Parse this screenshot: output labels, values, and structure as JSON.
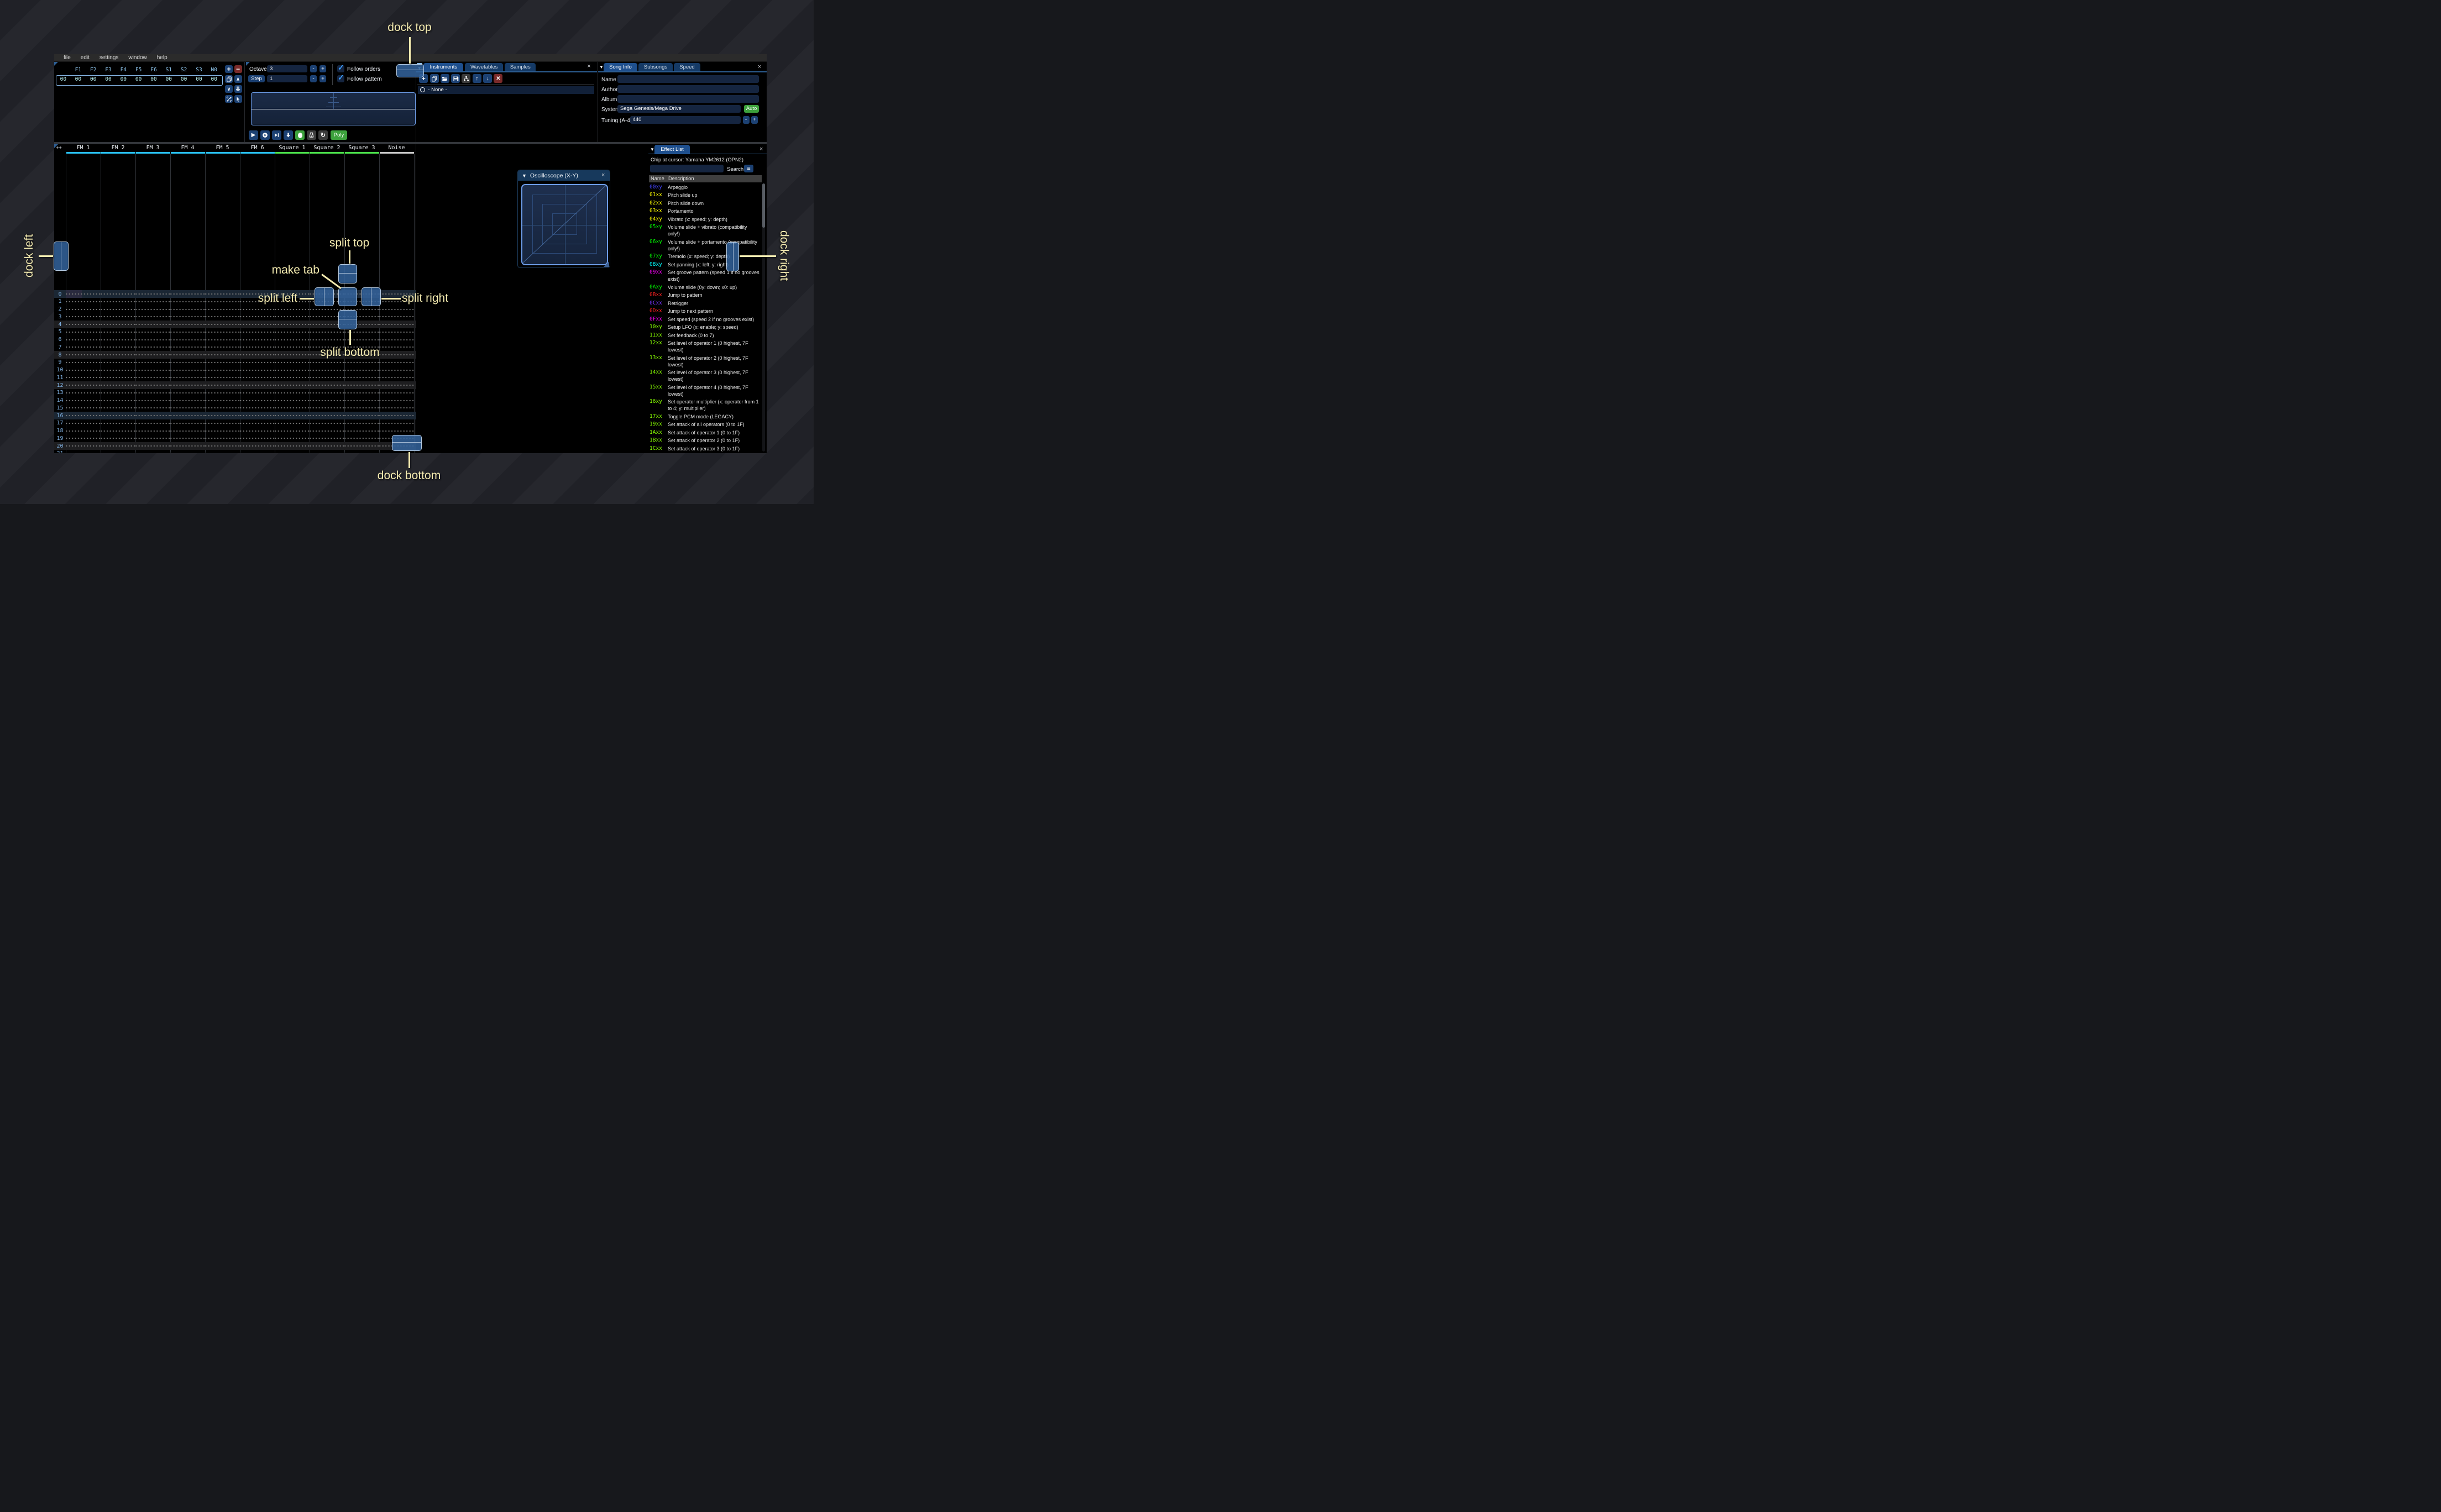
{
  "app": {
    "menu": [
      "file",
      "edit",
      "settings",
      "window",
      "help"
    ]
  },
  "order_list": {
    "row_number": "00",
    "channels": [
      "F1",
      "F2",
      "F3",
      "F4",
      "F5",
      "F6",
      "S1",
      "S2",
      "S3",
      "N0"
    ],
    "values": [
      "00",
      "00",
      "00",
      "00",
      "00",
      "00",
      "00",
      "00",
      "00",
      "00"
    ],
    "toolbar": [
      {
        "name": "add-order-button",
        "icon": "plus",
        "color": "b-blue"
      },
      {
        "name": "remove-order-button",
        "icon": "minus",
        "color": "b-red"
      },
      {
        "name": "duplicate-order-button",
        "icon": "copy",
        "color": "b-blue"
      },
      {
        "name": "move-order-up-button",
        "icon": "chev-up",
        "color": "b-blue"
      },
      {
        "name": "move-order-down-button",
        "icon": "chev-down",
        "color": "b-blue"
      },
      {
        "name": "duplicate-order-end-button",
        "icon": "chev-ddown",
        "color": "b-blue"
      },
      {
        "name": "order-change-mode-button",
        "icon": "unlink",
        "color": "b-blue"
      },
      {
        "name": "order-edit-mode-button",
        "icon": "cursor",
        "color": "b-blue"
      }
    ]
  },
  "edit_controls": {
    "octave_label": "Octave",
    "octave_value": "3",
    "step_label": "Step",
    "step_value": "1",
    "minus_label": "-",
    "plus_label": "+",
    "follow_orders_label": "Follow orders",
    "follow_pattern_label": "Follow pattern",
    "check_glyph": "✓"
  },
  "playback": {
    "buttons": [
      {
        "name": "play-button",
        "icon": "play",
        "color": "b-blue"
      },
      {
        "name": "play-pattern-button",
        "icon": "play-circle",
        "color": "b-blue"
      },
      {
        "name": "play-from-cursor-button",
        "icon": "play-bar",
        "color": "b-blue"
      },
      {
        "name": "step-one-row-button",
        "icon": "arrow-down-bold",
        "color": "b-blue"
      },
      {
        "name": "edit-record-button",
        "icon": "record-oval",
        "color": "b-green"
      },
      {
        "name": "metronome-button",
        "icon": "metronome",
        "color": "b-gray"
      },
      {
        "name": "repeat-pattern-button",
        "icon": "repeat",
        "color": "b-gray"
      }
    ],
    "poly_label": "Poly"
  },
  "instruments_panel": {
    "tabs": [
      {
        "label": "Instruments",
        "active": true
      },
      {
        "label": "Wavetables",
        "active": false
      },
      {
        "label": "Samples",
        "active": false
      }
    ],
    "close_glyph": "×",
    "collapse_glyph": "▼",
    "toolbar": [
      {
        "name": "add-instrument-button",
        "icon": "plus",
        "color": "b-blue"
      },
      {
        "name": "duplicate-instrument-button",
        "icon": "copy",
        "color": "b-blue"
      },
      {
        "name": "open-instrument-button",
        "icon": "folder",
        "color": "b-blue"
      },
      {
        "name": "save-instrument-button",
        "icon": "save",
        "color": "b-blue"
      },
      {
        "name": "instrument-folders-button",
        "icon": "tree",
        "color": "b-gray"
      },
      {
        "name": "move-instrument-up-button",
        "icon": "arrow-up",
        "color": "b-blue"
      },
      {
        "name": "move-instrument-down-button",
        "icon": "arrow-down",
        "color": "b-blue"
      },
      {
        "name": "delete-instrument-button",
        "icon": "cross",
        "color": "b-red"
      }
    ],
    "list": [
      {
        "label": "- None -"
      }
    ]
  },
  "song_info": {
    "tabs": [
      {
        "label": "Song Info",
        "active": true
      },
      {
        "label": "Subsongs",
        "active": false
      },
      {
        "label": "Speed",
        "active": false
      }
    ],
    "name_label": "Name",
    "name_value": "",
    "author_label": "Author",
    "author_value": "",
    "album_label": "Album",
    "album_value": "",
    "system_label": "System",
    "system_value": "Sega Genesis/Mega Drive",
    "auto_label": "Auto",
    "tuning_label": "Tuning (A-4)",
    "tuning_value": "440",
    "minus_label": "-",
    "plus_label": "+"
  },
  "oscilloscope": {
    "title": "Oscilloscope (X-Y)",
    "collapse_glyph": "▼",
    "close_glyph": "×"
  },
  "pattern": {
    "expand_label": "++",
    "row_count": 22,
    "highlight_minor": 4,
    "highlight_major": 16,
    "channels": [
      {
        "name": "FM 1",
        "color": "#29c0f0"
      },
      {
        "name": "FM 2",
        "color": "#29c0f0"
      },
      {
        "name": "FM 3",
        "color": "#29c0f0"
      },
      {
        "name": "FM 4",
        "color": "#29c0f0"
      },
      {
        "name": "FM 5",
        "color": "#29c0f0"
      },
      {
        "name": "FM 6",
        "color": "#29c0f0"
      },
      {
        "name": "Square 1",
        "color": "#4be04b"
      },
      {
        "name": "Square 2",
        "color": "#4be04b"
      },
      {
        "name": "Square 3",
        "color": "#4be04b"
      },
      {
        "name": "Noise",
        "color": "#c8c8c8"
      }
    ]
  },
  "effect_list": {
    "tab_label": "Effect List",
    "chip_line": "Chip at cursor: Yamaha YM2612 (OPN2)",
    "search_label": "Search",
    "search_value": "",
    "columns": [
      "Name",
      "Description"
    ],
    "rows": [
      {
        "code": "00xy",
        "color": "#4444ff",
        "desc": "Arpeggio"
      },
      {
        "code": "01xx",
        "color": "#ffff00",
        "desc": "Pitch slide up"
      },
      {
        "code": "02xx",
        "color": "#ffff00",
        "desc": "Pitch slide down"
      },
      {
        "code": "03xx",
        "color": "#ffff00",
        "desc": "Portamento"
      },
      {
        "code": "04xy",
        "color": "#ffff00",
        "desc": "Vibrato (x: speed; y: depth)"
      },
      {
        "code": "05xy",
        "color": "#00ff00",
        "desc": "Volume slide + vibrato (compatibility only!)"
      },
      {
        "code": "06xy",
        "color": "#00ff00",
        "desc": "Volume slide + portamento (compatibility only!)"
      },
      {
        "code": "07xy",
        "color": "#00ff00",
        "desc": "Tremolo (x: speed; y: depth)"
      },
      {
        "code": "08xy",
        "color": "#00ffff",
        "desc": "Set panning (x: left; y: right)"
      },
      {
        "code": "09xx",
        "color": "#ff00ff",
        "desc": "Set groove pattern (speed 1 if no grooves exist)"
      },
      {
        "code": "0Axy",
        "color": "#00ff00",
        "desc": "Volume slide (0y: down; x0: up)"
      },
      {
        "code": "0Bxx",
        "color": "#ff2222",
        "desc": "Jump to pattern"
      },
      {
        "code": "0Cxx",
        "color": "#7733ff",
        "desc": "Retrigger"
      },
      {
        "code": "0Dxx",
        "color": "#ff2222",
        "desc": "Jump to next pattern"
      },
      {
        "code": "0Fxx",
        "color": "#ff00ff",
        "desc": "Set speed (speed 2 if no grooves exist)"
      },
      {
        "code": "10xy",
        "color": "#88ff00",
        "desc": "Setup LFO (x: enable; y: speed)"
      },
      {
        "code": "11xx",
        "color": "#88ff00",
        "desc": "Set feedback (0 to 7)"
      },
      {
        "code": "12xx",
        "color": "#88ff00",
        "desc": "Set level of operator 1 (0 highest, 7F lowest)"
      },
      {
        "code": "13xx",
        "color": "#88ff00",
        "desc": "Set level of operator 2 (0 highest, 7F lowest)"
      },
      {
        "code": "14xx",
        "color": "#88ff00",
        "desc": "Set level of operator 3 (0 highest, 7F lowest)"
      },
      {
        "code": "15xx",
        "color": "#88ff00",
        "desc": "Set level of operator 4 (0 highest, 7F lowest)"
      },
      {
        "code": "16xy",
        "color": "#88ff00",
        "desc": "Set operator multiplier (x: operator from 1 to 4; y: multiplier)"
      },
      {
        "code": "17xx",
        "color": "#88ff00",
        "desc": "Toggle PCM mode (LEGACY)"
      },
      {
        "code": "19xx",
        "color": "#88ff00",
        "desc": "Set attack of all operators (0 to 1F)"
      },
      {
        "code": "1Axx",
        "color": "#88ff00",
        "desc": "Set attack of operator 1 (0 to 1F)"
      },
      {
        "code": "1Bxx",
        "color": "#88ff00",
        "desc": "Set attack of operator 2 (0 to 1F)"
      },
      {
        "code": "1Cxx",
        "color": "#88ff00",
        "desc": "Set attack of operator 3 (0 to 1F)"
      }
    ]
  },
  "annotations": {
    "dock_top": "dock top",
    "dock_left": "dock left",
    "dock_right": "dock right",
    "dock_bottom": "dock bottom",
    "split_top": "split top",
    "split_left": "split left",
    "split_right": "split right",
    "split_bottom": "split bottom",
    "make_tab": "make tab",
    "accent_color": "#f4ebb0"
  }
}
